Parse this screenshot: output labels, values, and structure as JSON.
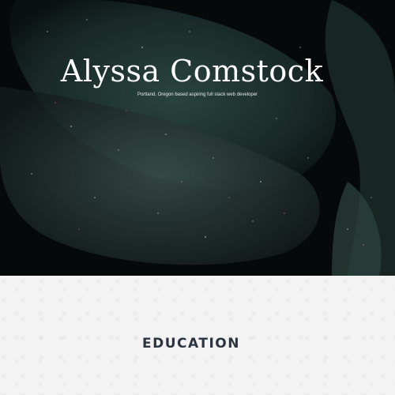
{
  "hero": {
    "title": "Alyssa Comstock",
    "subtitle": "Portland, Oregon based aspiring full stack web developer"
  },
  "section": {
    "heading": "EDUCATION"
  }
}
